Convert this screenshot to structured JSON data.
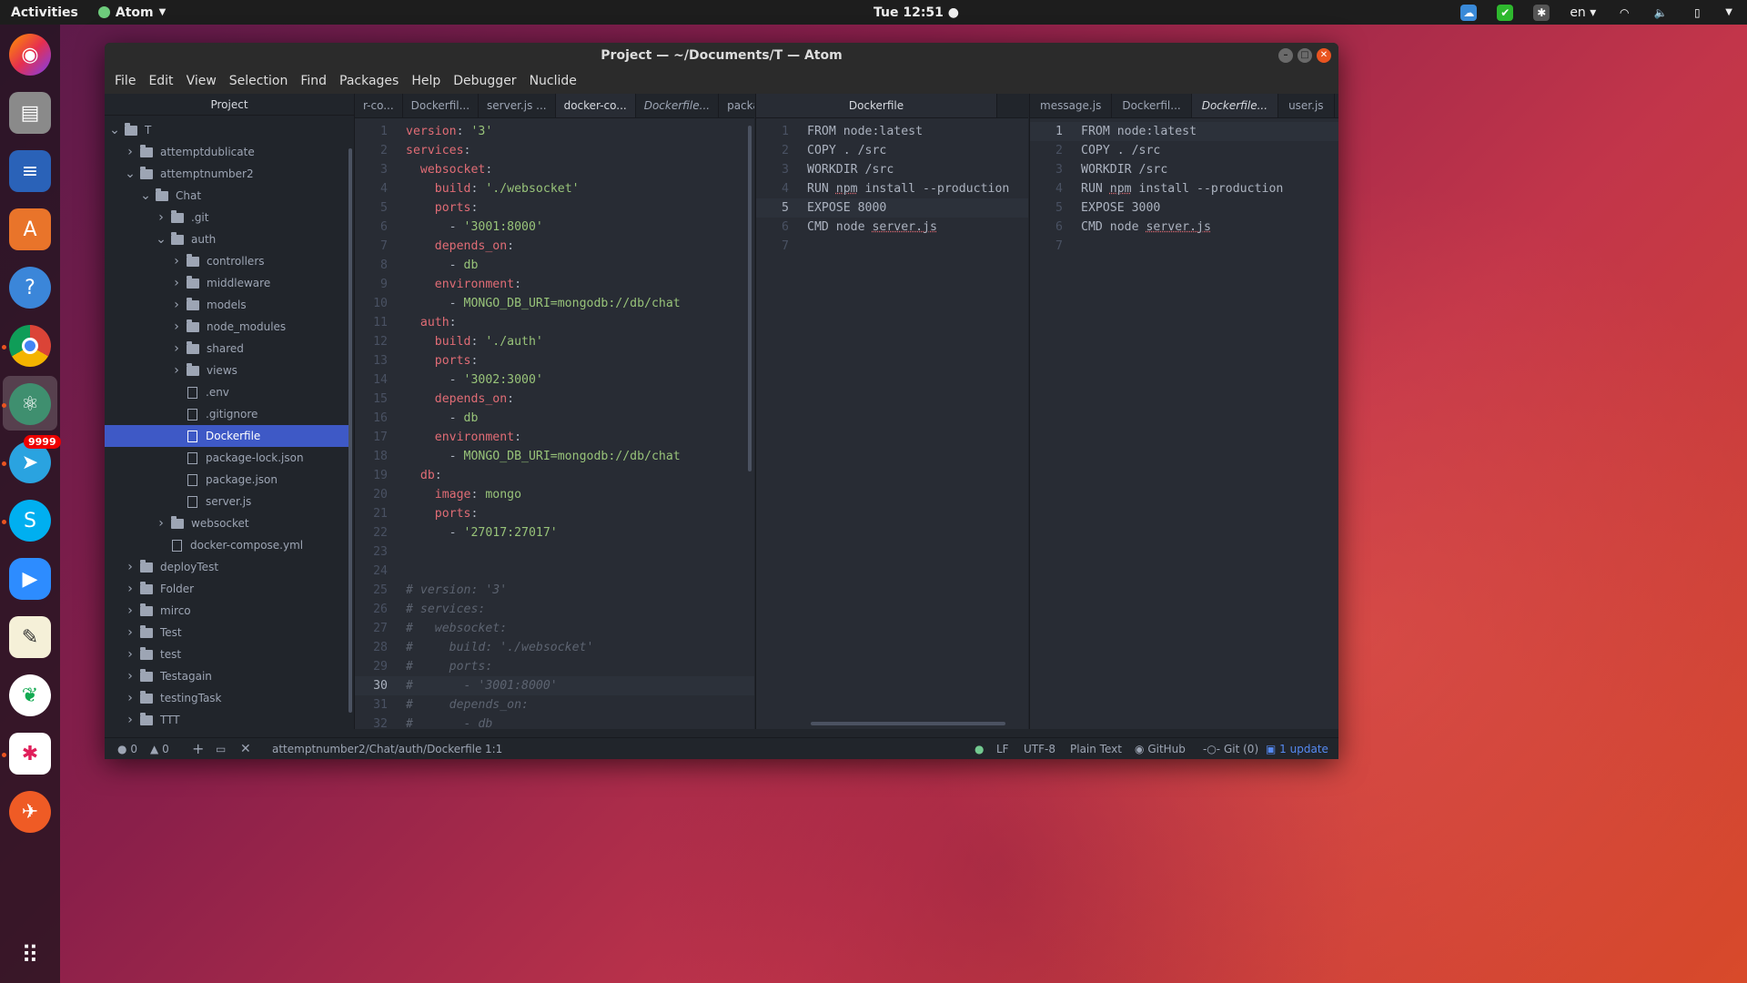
{
  "topbar": {
    "activities": "Activities",
    "app_name": "Atom",
    "clock": "Tue 12:51 ●",
    "language": "en"
  },
  "dock": {
    "items": [
      "firefox-icon",
      "files-icon",
      "writer-icon",
      "software-icon",
      "help-icon",
      "chrome-icon",
      "atom-icon",
      "telegram-icon",
      "skype-icon",
      "zoom-icon",
      "notes-icon",
      "mongodb-icon",
      "slack-icon",
      "postman-icon",
      "show-apps-icon"
    ],
    "telegram_badge": "9999"
  },
  "window": {
    "title": "Project — ~/Documents/T — Atom",
    "menu": [
      "File",
      "Edit",
      "View",
      "Selection",
      "Find",
      "Packages",
      "Help",
      "Debugger",
      "Nuclide"
    ]
  },
  "tree": {
    "header": "Project",
    "rows": [
      {
        "label": "T",
        "type": "folder",
        "open": true,
        "depth": 0
      },
      {
        "label": "attemptdublicate",
        "type": "folder",
        "open": false,
        "depth": 1
      },
      {
        "label": "attemptnumber2",
        "type": "folder",
        "open": true,
        "depth": 1
      },
      {
        "label": "Chat",
        "type": "folder",
        "open": true,
        "depth": 2
      },
      {
        "label": ".git",
        "type": "folder",
        "open": false,
        "depth": 3
      },
      {
        "label": "auth",
        "type": "folder",
        "open": true,
        "depth": 3
      },
      {
        "label": "controllers",
        "type": "folder",
        "open": false,
        "depth": 4
      },
      {
        "label": "middleware",
        "type": "folder",
        "open": false,
        "depth": 4
      },
      {
        "label": "models",
        "type": "folder",
        "open": false,
        "depth": 4
      },
      {
        "label": "node_modules",
        "type": "folder",
        "open": false,
        "depth": 4
      },
      {
        "label": "shared",
        "type": "folder",
        "open": false,
        "depth": 4
      },
      {
        "label": "views",
        "type": "folder",
        "open": false,
        "depth": 4
      },
      {
        "label": ".env",
        "type": "file",
        "depth": 4
      },
      {
        "label": ".gitignore",
        "type": "file",
        "depth": 4
      },
      {
        "label": "Dockerfile",
        "type": "file",
        "depth": 4,
        "selected": true
      },
      {
        "label": "package-lock.json",
        "type": "file",
        "depth": 4
      },
      {
        "label": "package.json",
        "type": "file",
        "depth": 4
      },
      {
        "label": "server.js",
        "type": "file",
        "depth": 4
      },
      {
        "label": "websocket",
        "type": "folder",
        "open": false,
        "depth": 3
      },
      {
        "label": "docker-compose.yml",
        "type": "file",
        "depth": 3
      },
      {
        "label": "deployTest",
        "type": "folder",
        "open": false,
        "depth": 1
      },
      {
        "label": "Folder",
        "type": "folder",
        "open": false,
        "depth": 1
      },
      {
        "label": "mirco",
        "type": "folder",
        "open": false,
        "depth": 1
      },
      {
        "label": "Test",
        "type": "folder",
        "open": false,
        "depth": 1
      },
      {
        "label": "test",
        "type": "folder",
        "open": false,
        "depth": 1
      },
      {
        "label": "Testagain",
        "type": "folder",
        "open": false,
        "depth": 1
      },
      {
        "label": "testingTask",
        "type": "folder",
        "open": false,
        "depth": 1
      },
      {
        "label": "TTT",
        "type": "folder",
        "open": false,
        "depth": 1
      }
    ]
  },
  "pane1": {
    "tabs": [
      {
        "label": "r-co...",
        "active": false,
        "italic": false
      },
      {
        "label": "Dockerfil...",
        "active": false,
        "italic": false
      },
      {
        "label": "server.js ...",
        "active": false,
        "italic": false
      },
      {
        "label": "docker-co...",
        "active": true,
        "italic": false
      },
      {
        "label": "Dockerfile...",
        "active": false,
        "italic": true
      },
      {
        "label": "package.j",
        "active": false,
        "italic": false
      }
    ],
    "cursor_line": 30,
    "lines": [
      [
        [
          "version",
          "k"
        ],
        [
          ": ",
          ""
        ],
        [
          "'3'",
          "s"
        ]
      ],
      [
        [
          "services",
          "k"
        ],
        [
          ":",
          ""
        ]
      ],
      [
        [
          "  websocket",
          "k"
        ],
        [
          ":",
          ""
        ]
      ],
      [
        [
          "    build",
          "k"
        ],
        [
          ": ",
          ""
        ],
        [
          "'./websocket'",
          "s"
        ]
      ],
      [
        [
          "    ports",
          "k"
        ],
        [
          ":",
          ""
        ]
      ],
      [
        [
          "      - ",
          ""
        ],
        [
          "'3001:8000'",
          "s"
        ]
      ],
      [
        [
          "    depends_on",
          "k"
        ],
        [
          ":",
          ""
        ]
      ],
      [
        [
          "      - ",
          ""
        ],
        [
          "db",
          "s"
        ]
      ],
      [
        [
          "    environment",
          "k"
        ],
        [
          ":",
          ""
        ]
      ],
      [
        [
          "      - ",
          ""
        ],
        [
          "MONGO_DB_URI=mongodb://db/chat",
          "s"
        ]
      ],
      [
        [
          "  auth",
          "k"
        ],
        [
          ":",
          ""
        ]
      ],
      [
        [
          "    build",
          "k"
        ],
        [
          ": ",
          ""
        ],
        [
          "'./auth'",
          "s"
        ]
      ],
      [
        [
          "    ports",
          "k"
        ],
        [
          ":",
          ""
        ]
      ],
      [
        [
          "      - ",
          ""
        ],
        [
          "'3002:3000'",
          "s"
        ]
      ],
      [
        [
          "    depends_on",
          "k"
        ],
        [
          ":",
          ""
        ]
      ],
      [
        [
          "      - ",
          ""
        ],
        [
          "db",
          "s"
        ]
      ],
      [
        [
          "    environment",
          "k"
        ],
        [
          ":",
          ""
        ]
      ],
      [
        [
          "      - ",
          ""
        ],
        [
          "MONGO_DB_URI=mongodb://db/chat",
          "s"
        ]
      ],
      [
        [
          "  db",
          "k"
        ],
        [
          ":",
          ""
        ]
      ],
      [
        [
          "    image",
          "k"
        ],
        [
          ": ",
          ""
        ],
        [
          "mongo",
          "s"
        ]
      ],
      [
        [
          "    ports",
          "k"
        ],
        [
          ":",
          ""
        ]
      ],
      [
        [
          "      - ",
          ""
        ],
        [
          "'27017:27017'",
          "s"
        ]
      ],
      [],
      [],
      [
        [
          "# version: '3'",
          "c"
        ]
      ],
      [
        [
          "# services:",
          "c"
        ]
      ],
      [
        [
          "#   websocket:",
          "c"
        ]
      ],
      [
        [
          "#     build: './websocket'",
          "c"
        ]
      ],
      [
        [
          "#     ports:",
          "c"
        ]
      ],
      [
        [
          "#       - '3001:8000'",
          "c"
        ]
      ],
      [
        [
          "#     depends_on:",
          "c"
        ]
      ],
      [
        [
          "#       - db",
          "c"
        ]
      ]
    ]
  },
  "pane2": {
    "tabs": [
      {
        "label": "Dockerfile",
        "active": true,
        "italic": false
      }
    ],
    "cursor_line": 5,
    "lines": [
      [
        [
          "FROM node:latest",
          ""
        ]
      ],
      [
        [
          "COPY . /src",
          ""
        ]
      ],
      [
        [
          "WORKDIR",
          ""
        ],
        [
          " /src",
          ""
        ]
      ],
      [
        [
          "RUN ",
          ""
        ],
        [
          "npm",
          "q"
        ],
        [
          " install --production",
          ""
        ]
      ],
      [
        [
          "EXPOSE 8000",
          ""
        ]
      ],
      [
        [
          "CMD",
          ""
        ],
        [
          " node ",
          ""
        ],
        [
          "server.js",
          "q"
        ]
      ],
      []
    ]
  },
  "pane3": {
    "tabs": [
      {
        "label": "message.js",
        "active": false,
        "italic": false
      },
      {
        "label": "Dockerfil...",
        "active": false,
        "italic": false
      },
      {
        "label": "Dockerfile...",
        "active": true,
        "italic": true
      },
      {
        "label": "user.js",
        "active": false,
        "italic": false
      }
    ],
    "cursor_line": 1,
    "lines": [
      [
        [
          "FROM node:latest",
          ""
        ]
      ],
      [
        [
          "COPY . /src",
          ""
        ]
      ],
      [
        [
          "WORKDIR",
          ""
        ],
        [
          " /src",
          ""
        ]
      ],
      [
        [
          "RUN ",
          ""
        ],
        [
          "npm",
          "q"
        ],
        [
          " install --production",
          ""
        ]
      ],
      [
        [
          "EXPOSE 3000",
          ""
        ]
      ],
      [
        [
          "CMD",
          ""
        ],
        [
          " node ",
          ""
        ],
        [
          "server.js",
          "q"
        ]
      ],
      []
    ]
  },
  "status": {
    "errors": "0",
    "warnings": "0",
    "path": "attemptnumber2/Chat/auth/Dockerfile",
    "position": "1:1",
    "line_ending": "LF",
    "encoding": "UTF-8",
    "grammar": "Plain Text",
    "github": "GitHub",
    "git": "Git (0)",
    "update": "1 update"
  }
}
